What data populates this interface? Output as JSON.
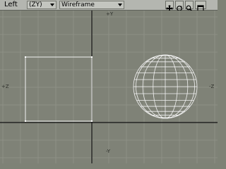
{
  "toolbar": {
    "view_name": "Left",
    "axis_select": "(ZY)",
    "render_mode": "Wireframe",
    "icons": [
      "move-icon",
      "rotate-icon",
      "zoom-icon",
      "maximize-icon"
    ]
  },
  "viewport": {
    "axis_labels": {
      "top": "+Y",
      "bottom": "-Y",
      "left": "+Z",
      "right": "-Z"
    }
  },
  "colors": {
    "background": "#7f8277",
    "grid": "#8d9086",
    "axis": "#111111",
    "wire": "#f2f2f2"
  }
}
